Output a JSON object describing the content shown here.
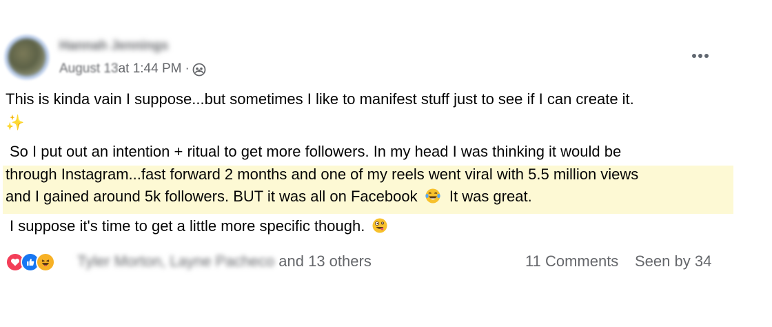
{
  "post": {
    "author_name": "Hannah Jennings",
    "date_blurred": "August 13",
    "time_text": " at 1:44 PM",
    "separator": "·",
    "audience_icon": "group-icon",
    "more_icon": "more-options-icon",
    "paragraph1": "This is kinda vain I suppose...but sometimes I like to manifest stuff just to see if I can create it.",
    "sparkle": "✨",
    "paragraph2_line1": "So I put out an intention + ritual to get more followers. In my head I was thinking it would be",
    "paragraph2_line2": "through Instagram...fast forward 2 months and one of my reels went viral with 5.5 million views",
    "paragraph2_line3_a": "and I gained around 5k followers. BUT it was all on Facebook",
    "paragraph2_line3_emoji": "tears-of-joy-emoji",
    "paragraph2_line3_b": "It was great.",
    "paragraph3": "I suppose it's time to get a little more specific though.",
    "paragraph3_emoji": "zany-face-emoji",
    "highlight_color": "#fdf9d4"
  },
  "footer": {
    "reaction_icons": [
      "love-reaction-icon",
      "like-reaction-icon",
      "haha-reaction-icon"
    ],
    "reactors_blurred": "Tyler Morton, Layne Pacheco",
    "reactors_suffix": " and 13 others",
    "comments": "11 Comments",
    "seen_by": "Seen by 34"
  }
}
